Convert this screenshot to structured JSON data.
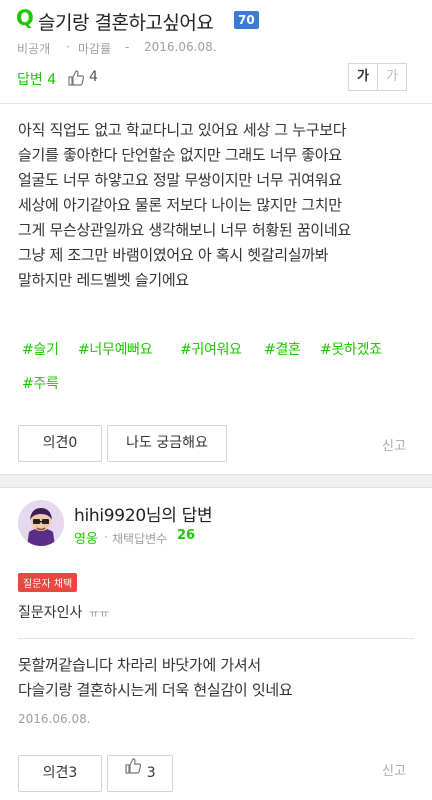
{
  "question": {
    "q_mark": "Q",
    "title": "슬기랑 결혼하고싶어요",
    "points": "70",
    "visibility": "비공개",
    "separator": "·",
    "status": "마감률",
    "status_suffix": "-",
    "date": "2016.06.08.",
    "answers_label": "답변 4",
    "likes": "4",
    "font_large": "가",
    "font_small": "가",
    "body_lines": [
      "아직 직업도 없고 학교다니고 있어요 세상 그 누구보다",
      "슬기를 좋아한다 단언할순 없지만 그래도 너무 좋아요",
      "얼굴도 너무 하얗고요 정말 무쌍이지만 너무 귀여워요",
      "세상에 아기같아요 물론 저보다 나이는 많지만 그치만",
      "그게 무슨상관일까요 생각해보니 너무 허황된 꿈이네요",
      "그냥 제 조그만 바램이였어요 아 혹시 헷갈리실까봐",
      "말하지만 레드벨벳 슬기에요"
    ],
    "tags": [
      "#슬기",
      "#너무예뻐요",
      "#귀여워요",
      "#결혼",
      "#못하겠죠",
      "#주륵"
    ],
    "opinion_button": "의견0",
    "curious_button": "나도 궁금해요",
    "report": "신고"
  },
  "answer": {
    "username": "hihi9920님의 답변",
    "rank": "영웅",
    "adopted_label": "채택답변수",
    "adopted_count": "26",
    "badge": "질문자 채택",
    "asker_greeting": "질문자인사",
    "asker_greeting_emote": "ㅠㅠ",
    "body_lines": [
      "못할꺼같습니다 차라리 바닷가에 가셔서",
      "다슬기랑 결혼하시는게 더욱 현실감이 잇네요"
    ],
    "date": "2016.06.08.",
    "opinion_button": "의견3",
    "likes": "3",
    "report": "신고"
  },
  "colors": {
    "accent_green": "#1ec800",
    "points_blue": "#3a7bd5",
    "badge_red": "#e8483f"
  }
}
